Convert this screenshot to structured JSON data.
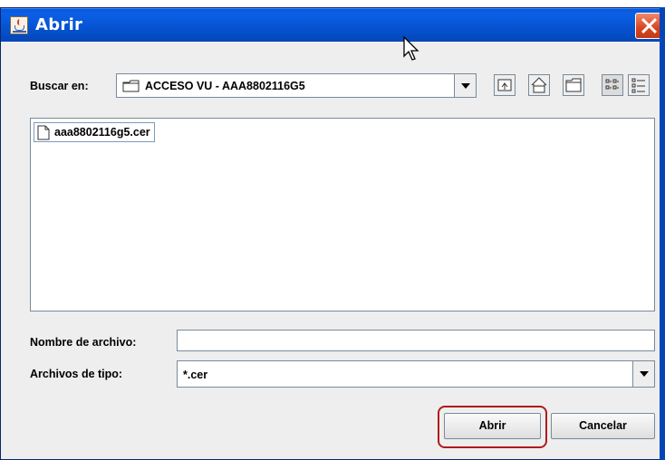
{
  "window": {
    "title": "Abrir"
  },
  "lookin": {
    "label": "Buscar en:",
    "value": "ACCESO VU - AAA8802116G5"
  },
  "toolbar": [
    "up-one-level-icon",
    "home-icon",
    "new-folder-icon",
    "list-view-icon",
    "details-view-icon"
  ],
  "files": [
    {
      "name": "aaa8802116g5.cer"
    }
  ],
  "filename": {
    "label": "Nombre de archivo:",
    "value": ""
  },
  "filetype": {
    "label": "Archivos de tipo:",
    "value": "*.cer"
  },
  "buttons": {
    "open": "Abrir",
    "cancel": "Cancelar"
  },
  "colors": {
    "titlebar": "#0552cf",
    "dialog_bg": "#eeeeee",
    "highlight": "#b01b1b"
  }
}
